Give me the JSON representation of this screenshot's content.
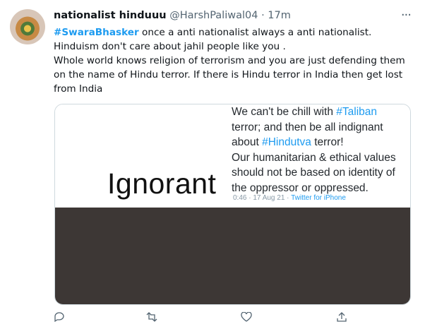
{
  "tweet": {
    "display_name": "nationalist hinduuu",
    "handle": "@HarshPaliwal04",
    "separator": "·",
    "time": "17m",
    "more_label": "···",
    "hashtag": "#SwaraBhasker",
    "line1_rest": " once a anti nationalist always a anti nationalist.",
    "line2": "Hinduism don't care about jahil people like you .",
    "line3": "Whole world knows religion of terrorism and  you are just defending them on the name of Hindu terror. If there is Hindu terror in India then get lost from India"
  },
  "media": {
    "word": "Ignorant",
    "embedded_tweet": {
      "pre1": "We can't be chill with ",
      "tag1": "#Taliban",
      "mid1": " terror; and then be all indignant about ",
      "tag2": "#Hindutva",
      "mid2": " terror!",
      "rest": "Our humanitarian & ethical values should not be based on identity of the oppressor or oppressed.",
      "time": "0:46 · 17 Aug 21 · ",
      "source": "Twitter for iPhone"
    }
  },
  "actions": {
    "reply": "reply-icon",
    "retweet": "retweet-icon",
    "like": "like-icon",
    "share": "share-icon"
  }
}
